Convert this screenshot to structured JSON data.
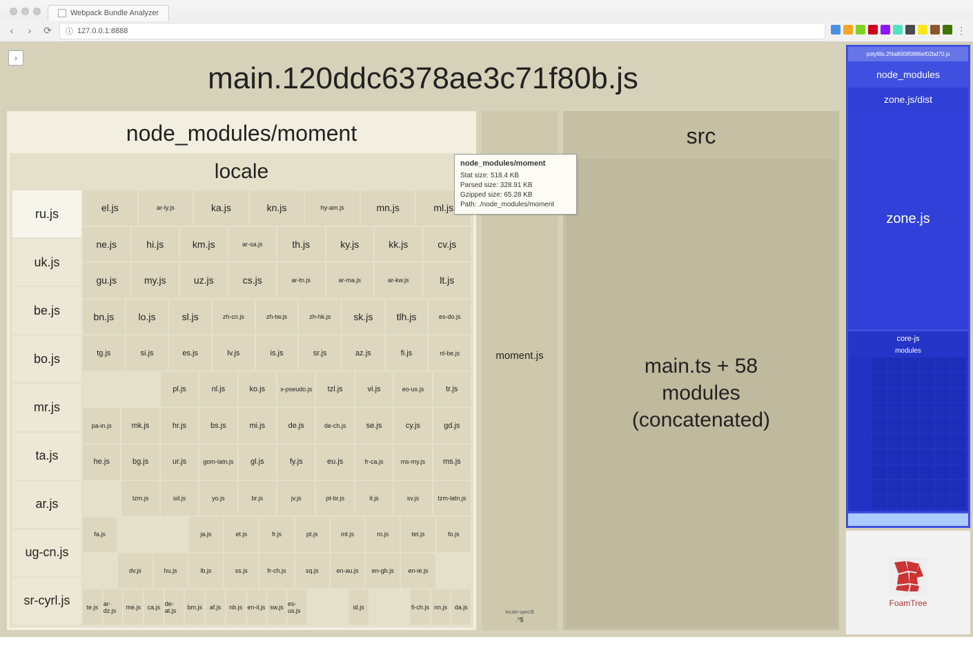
{
  "browser": {
    "tab_title": "Webpack Bundle Analyzer",
    "url": "127.0.0.1:8888",
    "security_icon": "insecure-icon",
    "extension_colors": [
      "#4a90e2",
      "#f5a623",
      "#7ed321",
      "#d0021b",
      "#9013fe",
      "#50e3c2",
      "#4a4a4a",
      "#f8e71c",
      "#8b572a",
      "#417505"
    ]
  },
  "toggle_label": "›",
  "main_bundle": {
    "title": "main.120ddc6378ae3c71f80b.js",
    "moment": {
      "title": "node_modules/moment",
      "locale_title": "locale",
      "left_column": [
        "ru.js",
        "uk.js",
        "be.js",
        "bo.js",
        "mr.js",
        "ta.js",
        "ar.js",
        "ug-cn.js",
        "sr-cyrl.js"
      ],
      "rows": [
        [
          "el.js",
          "ar-ly.js",
          "ka.js",
          "kn.js",
          "hy-am.js",
          "mn.js",
          "ml.js"
        ],
        [
          "ne.js",
          "hi.js",
          "km.js",
          "ar-sa.js",
          "th.js",
          "ky.js",
          "kk.js",
          "cv.js"
        ],
        [
          "gu.js",
          "my.js",
          "uz.js",
          "cs.js",
          "ar-tn.js",
          "ar-ma.js",
          "ar-kw.js",
          "lt.js"
        ],
        [
          "bn.js",
          "lo.js",
          "sl.js",
          "zh-cn.js",
          "zh-tw.js",
          "zh-hk.js",
          "sk.js",
          "tlh.js",
          "es-do.js"
        ],
        [
          "tg.js",
          "si.js",
          "es.js",
          "lv.js",
          "is.js",
          "sr.js",
          "az.js",
          "fi.js",
          "nl-be.js"
        ],
        [
          "",
          "",
          "pl.js",
          "nl.js",
          "ko.js",
          "x-pseudo.js",
          "tzl.js",
          "vi.js",
          "eo-us.js",
          "tr.js"
        ],
        [
          "pa-in.js",
          "mk.js",
          "hr.js",
          "bs.js",
          "mi.js",
          "de.js",
          "de-ch.js",
          "se.js",
          "cy.js",
          "gd.js"
        ],
        [
          "he.js",
          "bg.js",
          "ur.js",
          "gom-latn.js",
          "gl.js",
          "fy.js",
          "eu.js",
          "fr-ca.js",
          "ms-my.js",
          "ms.js"
        ],
        [
          "",
          "tzm.js",
          "sd.js",
          "yo.js",
          "br.js",
          "jv.js",
          "pt-br.js",
          "it.js",
          "sv.js",
          "tzm-latn.js"
        ],
        [
          "fa.js",
          "",
          "",
          "ja.js",
          "et.js",
          "fr.js",
          "pt.js",
          "mt.js",
          "ro.js",
          "tet.js",
          "fo.js"
        ],
        [
          "",
          "dv.js",
          "hu.js",
          "lb.js",
          "ss.js",
          "fr-ch.js",
          "sq.js",
          "en-au.js",
          "en-gb.js",
          "en-ie.js",
          ""
        ],
        [
          "te.js",
          "ar-dz.js",
          "me.js",
          "ca.js",
          "de-at.js",
          "bm.js",
          "af.js",
          "nb.js",
          "en-il.js",
          "sw.js",
          "es-us.js",
          "",
          "",
          "id.js",
          "",
          "",
          "fi-ch.js",
          "nn.js",
          "da.js"
        ]
      ],
      "momentjs_label": "moment.js",
      "extra_tiny_title": "locale-spec/$",
      "extra_label": ".*$"
    },
    "src": {
      "title": "src",
      "body": "main.ts + 58\nmodules\n(concatenated)"
    },
    "tooltip": {
      "title": "node_modules/moment",
      "stat": "Stat size: 518.4 KB",
      "parsed": "Parsed size: 328.91 KB",
      "gzipped": "Gzipped size: 65.28 KB",
      "path": "Path: ./node_modules/moment"
    }
  },
  "polyfills": {
    "title": "polyfills.2f4a80085886ef02bd70.js",
    "node_modules": "node_modules",
    "zone_dist": "zone.js/dist",
    "zone": "zone.js",
    "core_js": "core-js",
    "core_modules": "modules"
  },
  "foamtree": {
    "label": "FoamTree"
  }
}
